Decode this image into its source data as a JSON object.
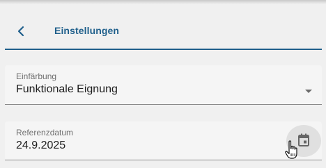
{
  "header": {
    "back_icon": "chevron-left-icon",
    "title": "Einstellungen",
    "accent_color": "#1f5f8b"
  },
  "fields": {
    "coloring": {
      "label": "Einfärbung",
      "value": "Funktionale Eignung",
      "icon": "dropdown-arrow-icon"
    },
    "reference_date": {
      "label": "Referenzdatum",
      "value": "24.9.2025",
      "icon": "calendar-icon"
    }
  },
  "cursor": "hand-pointer-icon"
}
